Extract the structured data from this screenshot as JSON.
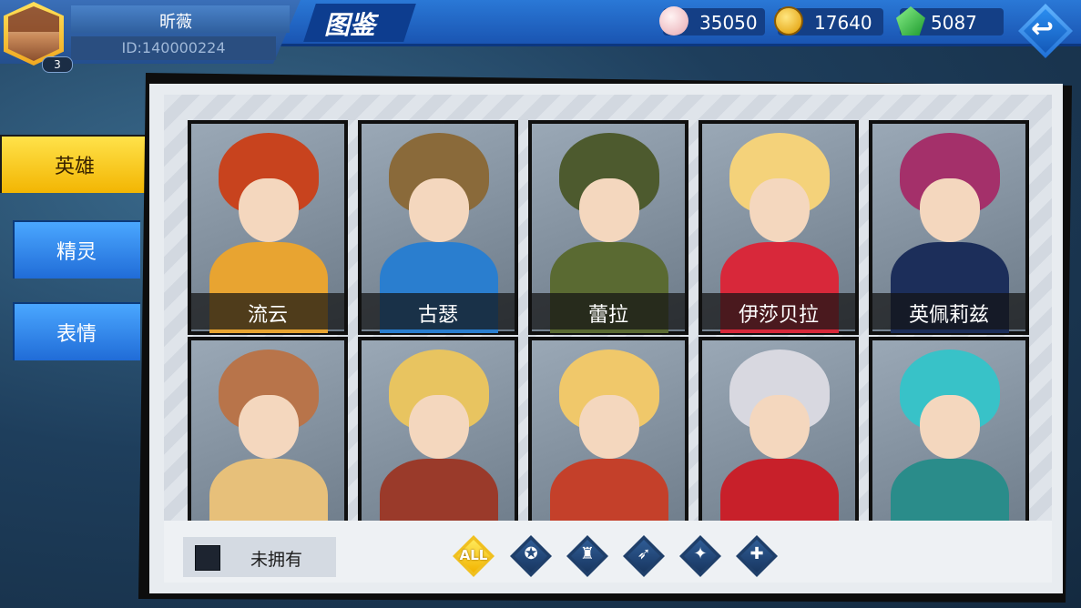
{
  "player": {
    "name": "昕薇",
    "id": "ID:140000224",
    "level": "3"
  },
  "page_title": "图鉴",
  "currencies": [
    {
      "icon": "shell-icon",
      "value": "35050",
      "color": "#f0c8cc"
    },
    {
      "icon": "gold-coin-icon",
      "value": "17640",
      "color": "#f6c21a"
    },
    {
      "icon": "green-gem-plus-icon",
      "value": "5087",
      "color": "#35c24a"
    }
  ],
  "tabs": [
    {
      "label": "英雄",
      "active": true
    },
    {
      "label": "精灵",
      "active": false
    },
    {
      "label": "表情",
      "active": false
    }
  ],
  "heroes": [
    {
      "name": "流云",
      "hair": "#c8431e",
      "body": "#e8a431"
    },
    {
      "name": "古瑟",
      "hair": "#8a6a3a",
      "body": "#2a7ecf"
    },
    {
      "name": "蕾拉",
      "hair": "#4d5a2e",
      "body": "#5a6a32"
    },
    {
      "name": "伊莎贝拉",
      "hair": "#f4d27a",
      "body": "#d8283a"
    },
    {
      "name": "英佩莉兹",
      "hair": "#a4306a",
      "body": "#1c2e5a"
    },
    {
      "name": "",
      "hair": "#b8744a",
      "body": "#e7c07a"
    },
    {
      "name": "",
      "hair": "#e8c460",
      "body": "#9a3a2a"
    },
    {
      "name": "",
      "hair": "#f0c86a",
      "body": "#c4402a"
    },
    {
      "name": "",
      "hair": "#d8d8e0",
      "body": "#c8202a"
    },
    {
      "name": "",
      "hair": "#38c2c8",
      "body": "#2a8c8a"
    }
  ],
  "bottom": {
    "owned_label": "未拥有"
  },
  "filters": [
    {
      "name": "filter-all",
      "glyph": "ALL"
    },
    {
      "name": "filter-tank-icon",
      "glyph": "✪"
    },
    {
      "name": "filter-warrior-icon",
      "glyph": "♜"
    },
    {
      "name": "filter-archer-icon",
      "glyph": "➶"
    },
    {
      "name": "filter-mage-icon",
      "glyph": "✦"
    },
    {
      "name": "filter-support-icon",
      "glyph": "✚"
    }
  ],
  "colors": {
    "accent_yellow": "#f2b400",
    "tab_blue": "#1f6ad6",
    "header_blue": "#1a55b2"
  }
}
